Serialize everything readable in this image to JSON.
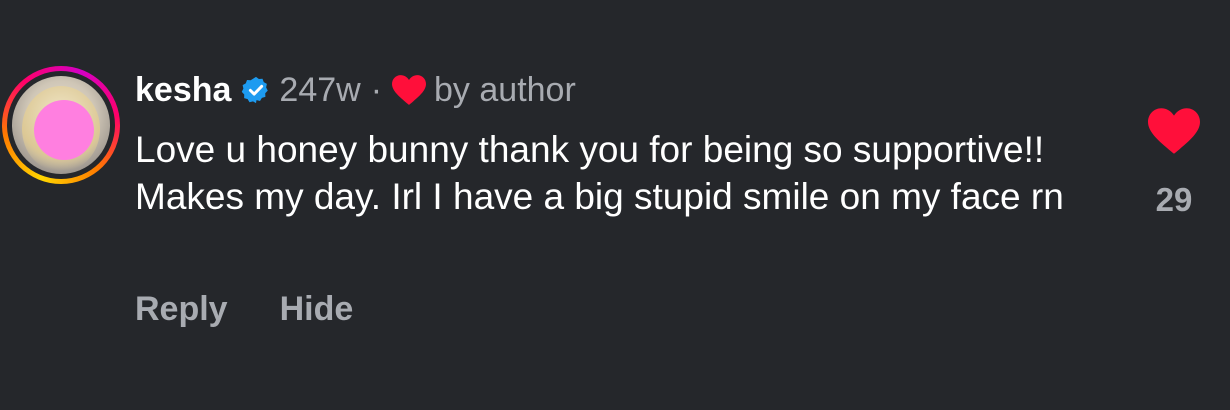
{
  "comment": {
    "username": "kesha",
    "verified_icon": "verified-badge-icon",
    "age": "247w",
    "separator": "·",
    "liked_by_author_text": "by author",
    "text": "Love u honey bunny thank you for being so supportive!! Makes my day. Irl I have a big stupid smile on my face rn",
    "actions": {
      "reply": "Reply",
      "hide": "Hide"
    },
    "like_count": "29"
  },
  "colors": {
    "background": "#25272b",
    "heart": "#ff0f3a",
    "verified": "#1d9bf0",
    "muted_text": "#a8abb1"
  }
}
